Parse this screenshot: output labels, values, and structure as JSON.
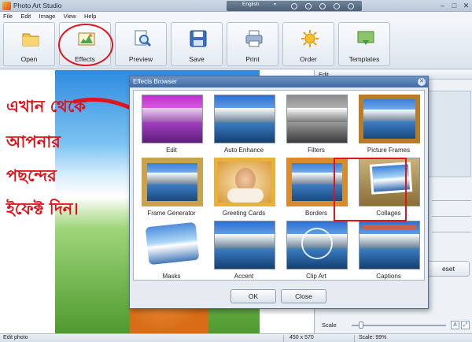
{
  "window": {
    "title": "Photo Art Studio",
    "language": "English"
  },
  "menu": [
    "File",
    "Edit",
    "Image",
    "View",
    "Help"
  ],
  "toolbar": {
    "buttons": [
      {
        "label": "Open",
        "icon": "folder-icon"
      },
      {
        "label": "Effects",
        "icon": "effects-icon"
      },
      {
        "label": "Preview",
        "icon": "preview-icon"
      },
      {
        "label": "Save",
        "icon": "save-icon"
      },
      {
        "label": "Print",
        "icon": "print-icon"
      },
      {
        "label": "Order",
        "icon": "order-icon"
      },
      {
        "label": "Templates",
        "icon": "templates-icon"
      }
    ]
  },
  "overlay_text": [
    "এখান থেকে",
    "আপনার",
    "পছন্দের",
    "ইফেক্ট দিন।"
  ],
  "right_panel": {
    "header": "Edit",
    "reset_label": "eset",
    "scale_label": "Scale"
  },
  "dialog": {
    "title": "Effects Browser",
    "items": [
      "Edit",
      "Auto Enhance",
      "Filters",
      "Picture Frames",
      "Frame Generator",
      "Greeting Cards",
      "Borders",
      "Collages",
      "Masks",
      "Accent",
      "Clip Art",
      "Captions"
    ],
    "selected": "Greeting Cards",
    "ok_label": "OK",
    "close_label": "Close"
  },
  "status": {
    "left": "Edit photo",
    "size": "450 x 570",
    "scale": "Scale: 99%"
  },
  "colors": {
    "annotation_red": "#e0141d",
    "dialog_title": "#3f6aa6"
  }
}
